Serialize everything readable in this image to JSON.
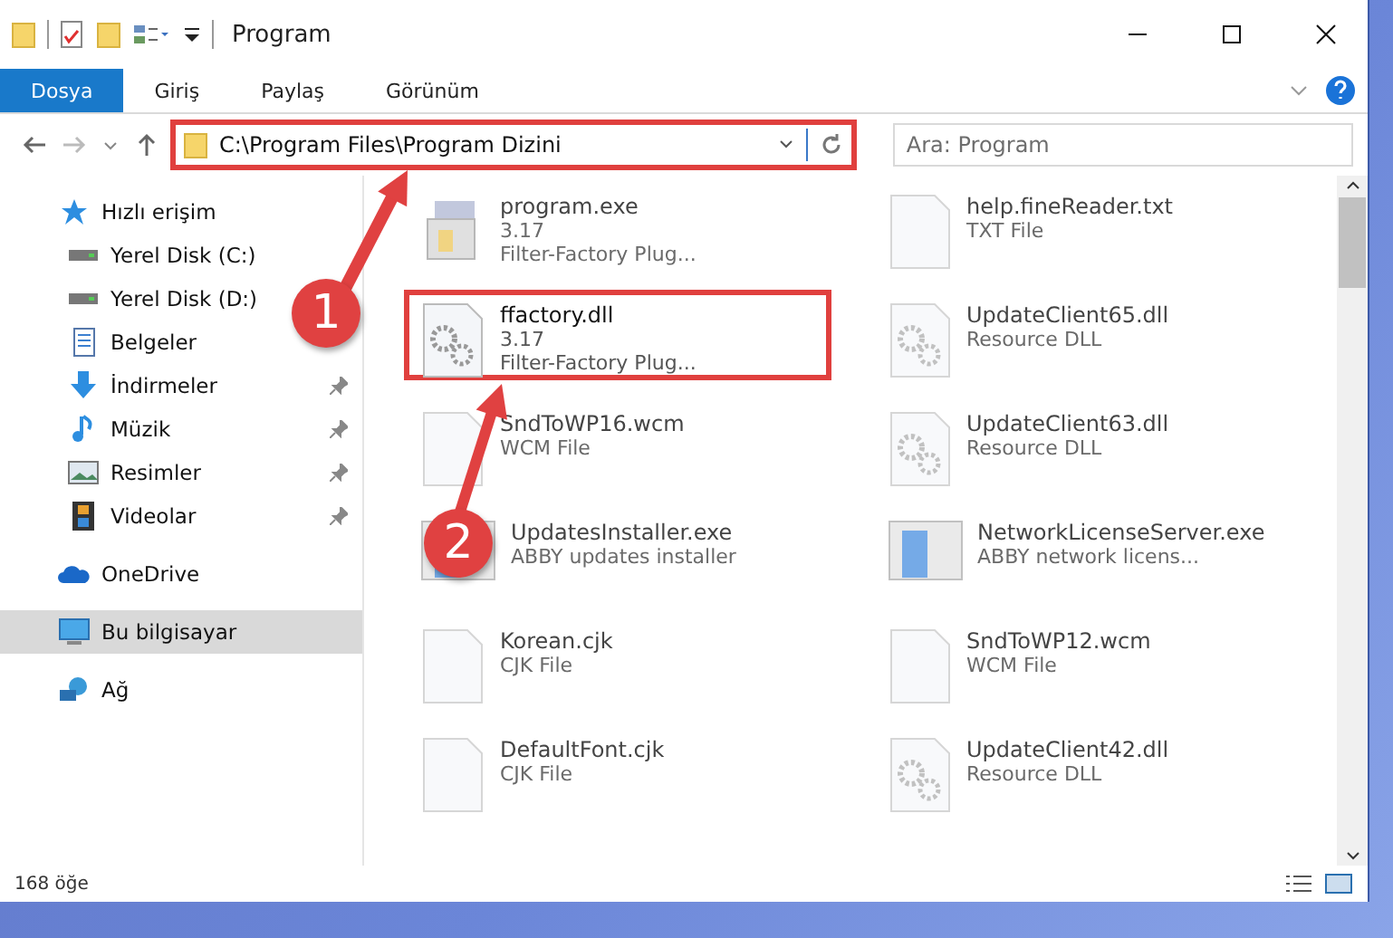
{
  "window": {
    "title": "Program"
  },
  "ribbon_tabs": [
    {
      "label": "Dosya",
      "selected": true
    },
    {
      "label": "Giriş",
      "selected": false
    },
    {
      "label": "Paylaş",
      "selected": false
    },
    {
      "label": "Görünüm",
      "selected": false
    }
  ],
  "address": {
    "path": "C:\\Program Files\\Program Dizini",
    "highlighted": true
  },
  "search": {
    "placeholder": "Ara: Program"
  },
  "sidebar": {
    "items": [
      {
        "label": "Hızlı erişim",
        "kind": "quick",
        "pinned": false,
        "selected": false,
        "children": [
          {
            "label": "Yerel Disk (C:)",
            "kind": "disk",
            "pinned": false,
            "selected": false
          },
          {
            "label": "Yerel Disk (D:)",
            "kind": "disk",
            "pinned": false,
            "selected": false
          },
          {
            "label": "Belgeler",
            "kind": "docs",
            "pinned": false,
            "selected": false
          },
          {
            "label": "İndirmeler",
            "kind": "download",
            "pinned": true,
            "selected": false
          },
          {
            "label": "Müzik",
            "kind": "music",
            "pinned": true,
            "selected": false
          },
          {
            "label": "Resimler",
            "kind": "pictures",
            "pinned": true,
            "selected": false
          },
          {
            "label": "Videolar",
            "kind": "videos",
            "pinned": true,
            "selected": false
          }
        ]
      },
      {
        "label": "OneDrive",
        "kind": "cloud",
        "pinned": false,
        "selected": false
      },
      {
        "label": "Bu bilgisayar",
        "kind": "pc",
        "pinned": false,
        "selected": true
      },
      {
        "label": "Ağ",
        "kind": "network",
        "pinned": false,
        "selected": false
      }
    ]
  },
  "files": [
    {
      "name": "program.exe",
      "lines": [
        "3.17",
        "Filter-Factory Plug..."
      ],
      "kind": "exe",
      "blurred": true,
      "highlighted": false
    },
    {
      "name": "help.fineReader.txt",
      "lines": [
        "TXT File"
      ],
      "kind": "blank",
      "blurred": true,
      "highlighted": false
    },
    {
      "name": "ffactory.dll",
      "lines": [
        "3.17",
        "Filter-Factory Plug..."
      ],
      "kind": "dll",
      "blurred": false,
      "highlighted": true
    },
    {
      "name": "UpdateClient65.dll",
      "lines": [
        "Resource DLL"
      ],
      "kind": "dll",
      "blurred": true,
      "highlighted": false
    },
    {
      "name": "SndToWP16.wcm",
      "lines": [
        "WCM File"
      ],
      "kind": "blank",
      "blurred": true,
      "highlighted": false
    },
    {
      "name": "UpdateClient63.dll",
      "lines": [
        "Resource DLL"
      ],
      "kind": "dll",
      "blurred": true,
      "highlighted": false
    },
    {
      "name": "UpdatesInstaller.exe",
      "lines": [
        "ABBY updates installer"
      ],
      "kind": "app",
      "blurred": true,
      "highlighted": false
    },
    {
      "name": "NetworkLicenseServer.exe",
      "lines": [
        "ABBY network licens..."
      ],
      "kind": "app",
      "blurred": true,
      "highlighted": false
    },
    {
      "name": "Korean.cjk",
      "lines": [
        "CJK File"
      ],
      "kind": "blank",
      "blurred": true,
      "highlighted": false
    },
    {
      "name": "SndToWP12.wcm",
      "lines": [
        "WCM File"
      ],
      "kind": "blank",
      "blurred": true,
      "highlighted": false
    },
    {
      "name": "DefaultFont.cjk",
      "lines": [
        "CJK File"
      ],
      "kind": "blank",
      "blurred": true,
      "highlighted": false
    },
    {
      "name": "UpdateClient42.dll",
      "lines": [
        "Resource DLL"
      ],
      "kind": "dll",
      "blurred": true,
      "highlighted": false
    }
  ],
  "status_bar": {
    "count": "168 öğe"
  },
  "annotations": [
    {
      "number": "1"
    },
    {
      "number": "2"
    }
  ]
}
